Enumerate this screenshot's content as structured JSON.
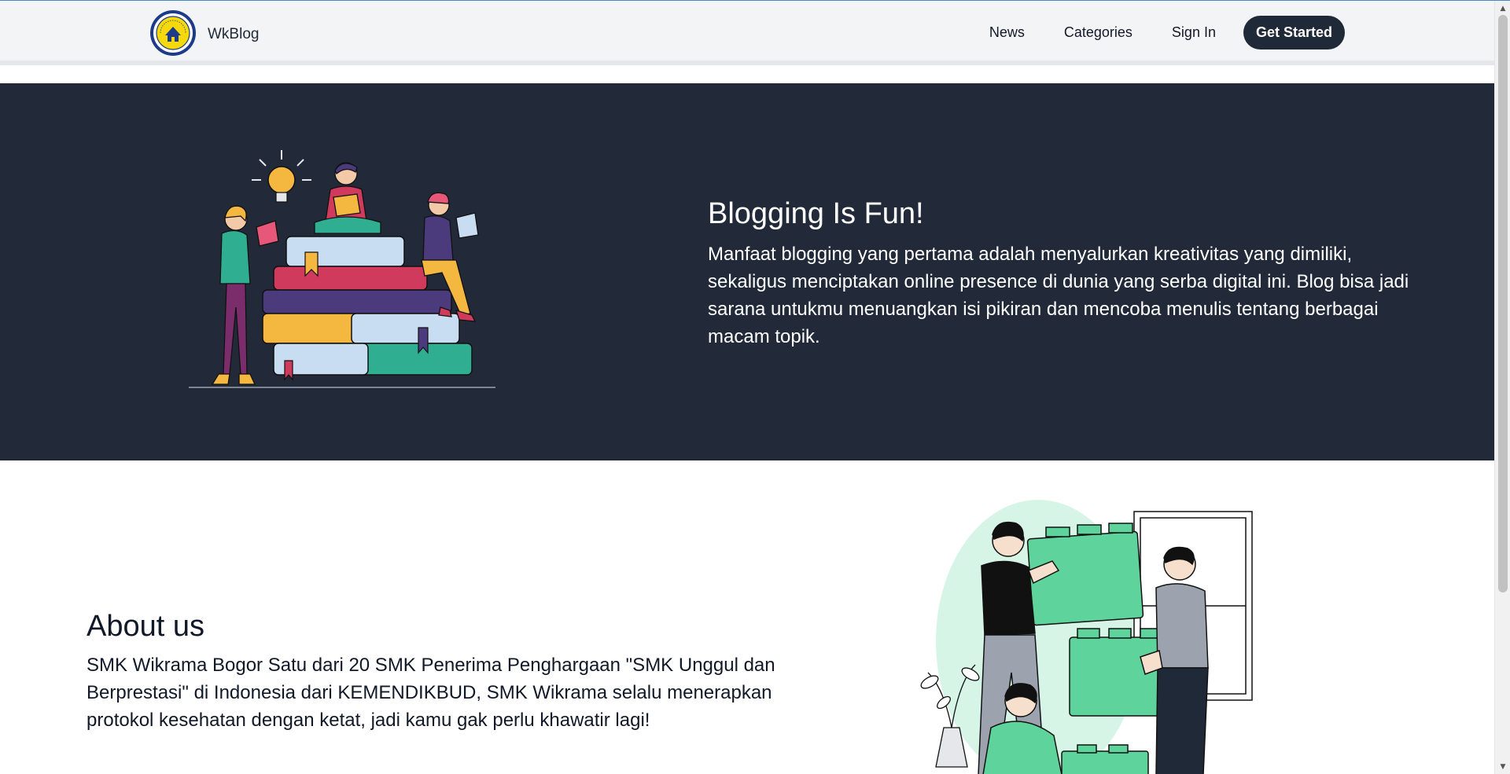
{
  "brand": {
    "name": "WkBlog",
    "logo_icon": "smk-wikrama-logo-icon"
  },
  "nav": {
    "links": [
      {
        "label": "News"
      },
      {
        "label": "Categories"
      },
      {
        "label": "Sign In"
      }
    ],
    "cta_label": "Get Started"
  },
  "hero": {
    "title": "Blogging Is Fun!",
    "body": "Manfaat blogging yang pertama adalah menyalurkan kreativitas yang dimiliki, sekaligus menciptakan online presence di dunia yang serba digital ini. Blog bisa jadi sarana untukmu menuangkan isi pikiran dan mencoba menulis tentang berbagai macam topik.",
    "illustration_icon": "people-reading-books-illustration"
  },
  "about": {
    "title": "About us",
    "body": "SMK Wikrama Bogor Satu dari 20 SMK Penerima Penghargaan \"SMK Unggul dan Berprestasi\" di Indonesia dari KEMENDIKBUD, SMK Wikrama selalu menerapkan protokol kesehatan dengan ketat, jadi kamu gak perlu khawatir lagi!",
    "illustration_icon": "team-building-blocks-illustration"
  },
  "colors": {
    "navbar_bg": "#f3f4f6",
    "hero_bg": "#222a39",
    "cta_bg": "#1f2937",
    "accent_green": "#5fd39c"
  }
}
